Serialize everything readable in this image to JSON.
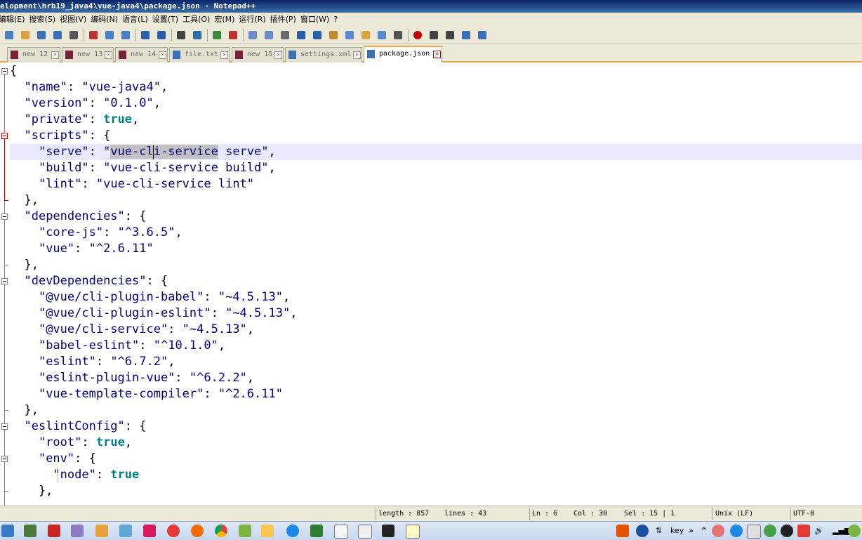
{
  "window": {
    "title": "elopment\\hrb19_java4\\vue-java4\\package.json - Notepad++"
  },
  "menu": [
    "编辑(E)",
    "搜索(S)",
    "视图(V)",
    "编码(N)",
    "语言(L)",
    "设置(T)",
    "工具(O)",
    "宏(M)",
    "运行(R)",
    "插件(P)",
    "窗口(W)",
    "?"
  ],
  "toolbar_icons": [
    "new-file-icon",
    "open-file-icon",
    "save-icon",
    "save-all-icon",
    "print-icon",
    "cut-icon",
    "copy-icon",
    "paste-icon",
    "undo-icon",
    "redo-icon",
    "find-icon",
    "replace-icon",
    "zoom-in-icon",
    "zoom-out-icon",
    "sync-vertical-icon",
    "sync-horizontal-icon",
    "word-wrap-icon",
    "show-all-chars-icon",
    "indent-guide-icon",
    "function-list-icon",
    "doc-map-icon",
    "folder-workspace-icon",
    "monitor-icon",
    "eye-icon",
    "record-macro-icon",
    "stop-macro-icon",
    "play-macro-icon",
    "run-macro-multiple-icon",
    "save-macro-icon"
  ],
  "tabs": [
    {
      "label": "new 12",
      "active": false
    },
    {
      "label": "new 13",
      "active": false
    },
    {
      "label": "new 14",
      "active": false
    },
    {
      "label": "file.txt",
      "active": false
    },
    {
      "label": "new 15",
      "active": false
    },
    {
      "label": "settings.xml",
      "active": false
    },
    {
      "label": "package.json",
      "active": true
    }
  ],
  "code": {
    "current_line": 6,
    "lines": [
      [
        {
          "t": "{",
          "c": ""
        }
      ],
      [
        {
          "t": "  ",
          "c": ""
        },
        {
          "t": "\"name\"",
          "c": "k"
        },
        {
          "t": ": ",
          "c": ""
        },
        {
          "t": "\"vue-java4\"",
          "c": "s"
        },
        {
          "t": ",",
          "c": ""
        }
      ],
      [
        {
          "t": "  ",
          "c": ""
        },
        {
          "t": "\"version\"",
          "c": "k"
        },
        {
          "t": ": ",
          "c": ""
        },
        {
          "t": "\"0.1.0\"",
          "c": "s"
        },
        {
          "t": ",",
          "c": ""
        }
      ],
      [
        {
          "t": "  ",
          "c": ""
        },
        {
          "t": "\"private\"",
          "c": "k"
        },
        {
          "t": ": ",
          "c": ""
        },
        {
          "t": "true",
          "c": "b"
        },
        {
          "t": ",",
          "c": ""
        }
      ],
      [
        {
          "t": "  ",
          "c": ""
        },
        {
          "t": "\"scripts\"",
          "c": "k"
        },
        {
          "t": ": {",
          "c": ""
        }
      ],
      [
        {
          "t": "    ",
          "c": ""
        },
        {
          "t": "\"serve\"",
          "c": "k"
        },
        {
          "t": ": ",
          "c": ""
        },
        {
          "t": "\"",
          "c": "s"
        },
        {
          "t": "vue-cli-service",
          "c": "s sel"
        },
        {
          "t": " serve\"",
          "c": "s"
        },
        {
          "t": ",",
          "c": ""
        }
      ],
      [
        {
          "t": "    ",
          "c": ""
        },
        {
          "t": "\"build\"",
          "c": "k"
        },
        {
          "t": ": ",
          "c": ""
        },
        {
          "t": "\"vue-cli-service build\"",
          "c": "s"
        },
        {
          "t": ",",
          "c": ""
        }
      ],
      [
        {
          "t": "    ",
          "c": ""
        },
        {
          "t": "\"lint\"",
          "c": "k"
        },
        {
          "t": ": ",
          "c": ""
        },
        {
          "t": "\"vue-cli-service lint\"",
          "c": "s"
        }
      ],
      [
        {
          "t": "  },",
          "c": ""
        }
      ],
      [
        {
          "t": "  ",
          "c": ""
        },
        {
          "t": "\"dependencies\"",
          "c": "k"
        },
        {
          "t": ": {",
          "c": ""
        }
      ],
      [
        {
          "t": "    ",
          "c": ""
        },
        {
          "t": "\"core-js\"",
          "c": "k"
        },
        {
          "t": ": ",
          "c": ""
        },
        {
          "t": "\"^3.6.5\"",
          "c": "s"
        },
        {
          "t": ",",
          "c": ""
        }
      ],
      [
        {
          "t": "    ",
          "c": ""
        },
        {
          "t": "\"vue\"",
          "c": "k"
        },
        {
          "t": ": ",
          "c": ""
        },
        {
          "t": "\"^2.6.11\"",
          "c": "s"
        }
      ],
      [
        {
          "t": "  },",
          "c": ""
        }
      ],
      [
        {
          "t": "  ",
          "c": ""
        },
        {
          "t": "\"devDependencies\"",
          "c": "k"
        },
        {
          "t": ": {",
          "c": ""
        }
      ],
      [
        {
          "t": "    ",
          "c": ""
        },
        {
          "t": "\"@vue/cli-plugin-babel\"",
          "c": "k"
        },
        {
          "t": ": ",
          "c": ""
        },
        {
          "t": "\"~4.5.13\"",
          "c": "s"
        },
        {
          "t": ",",
          "c": ""
        }
      ],
      [
        {
          "t": "    ",
          "c": ""
        },
        {
          "t": "\"@vue/cli-plugin-eslint\"",
          "c": "k"
        },
        {
          "t": ": ",
          "c": ""
        },
        {
          "t": "\"~4.5.13\"",
          "c": "s"
        },
        {
          "t": ",",
          "c": ""
        }
      ],
      [
        {
          "t": "    ",
          "c": ""
        },
        {
          "t": "\"@vue/cli-service\"",
          "c": "k"
        },
        {
          "t": ": ",
          "c": ""
        },
        {
          "t": "\"~4.5.13\"",
          "c": "s"
        },
        {
          "t": ",",
          "c": ""
        }
      ],
      [
        {
          "t": "    ",
          "c": ""
        },
        {
          "t": "\"babel-eslint\"",
          "c": "k"
        },
        {
          "t": ": ",
          "c": ""
        },
        {
          "t": "\"^10.1.0\"",
          "c": "s"
        },
        {
          "t": ",",
          "c": ""
        }
      ],
      [
        {
          "t": "    ",
          "c": ""
        },
        {
          "t": "\"eslint\"",
          "c": "k"
        },
        {
          "t": ": ",
          "c": ""
        },
        {
          "t": "\"^6.7.2\"",
          "c": "s"
        },
        {
          "t": ",",
          "c": ""
        }
      ],
      [
        {
          "t": "    ",
          "c": ""
        },
        {
          "t": "\"eslint-plugin-vue\"",
          "c": "k"
        },
        {
          "t": ": ",
          "c": ""
        },
        {
          "t": "\"^6.2.2\"",
          "c": "s"
        },
        {
          "t": ",",
          "c": ""
        }
      ],
      [
        {
          "t": "    ",
          "c": ""
        },
        {
          "t": "\"vue-template-compiler\"",
          "c": "k"
        },
        {
          "t": ": ",
          "c": ""
        },
        {
          "t": "\"^2.6.11\"",
          "c": "s"
        }
      ],
      [
        {
          "t": "  },",
          "c": ""
        }
      ],
      [
        {
          "t": "  ",
          "c": ""
        },
        {
          "t": "\"eslintConfig\"",
          "c": "k"
        },
        {
          "t": ": {",
          "c": ""
        }
      ],
      [
        {
          "t": "    ",
          "c": ""
        },
        {
          "t": "\"root\"",
          "c": "k"
        },
        {
          "t": ": ",
          "c": ""
        },
        {
          "t": "true",
          "c": "b"
        },
        {
          "t": ",",
          "c": ""
        }
      ],
      [
        {
          "t": "    ",
          "c": ""
        },
        {
          "t": "\"env\"",
          "c": "k"
        },
        {
          "t": ": {",
          "c": ""
        }
      ],
      [
        {
          "t": "      ",
          "c": ""
        },
        {
          "t": "\"node\"",
          "c": "k"
        },
        {
          "t": ": ",
          "c": ""
        },
        {
          "t": "true",
          "c": "b"
        }
      ],
      [
        {
          "t": "    },",
          "c": ""
        }
      ]
    ]
  },
  "status": {
    "length": "length : 857",
    "lines": "lines : 43",
    "ln": "Ln : 6",
    "col": "Col : 30",
    "sel": "Sel : 15 | 1",
    "eol": "Unix (LF)",
    "encoding": "UTF-8"
  },
  "taskbar": {
    "tray_label": "key",
    "tray_chevron": "»",
    "tray_caret": "^"
  },
  "colors": {
    "keyword": "#000080",
    "boolean": "#008080",
    "selection": "#c0c0c0",
    "current_line": "#e8e8ff",
    "tab_accent": "#f7a640"
  }
}
